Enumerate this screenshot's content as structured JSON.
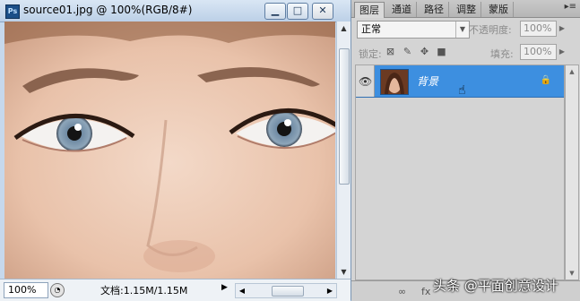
{
  "document": {
    "title": "source01.jpg @ 100%(RGB/8#)",
    "app_badge": "Ps",
    "buttons": {
      "minimize": "▁",
      "restore": "□",
      "close": "✕"
    },
    "status": {
      "zoom": "100%",
      "doc_info": "文档:1.15M/1.15M"
    }
  },
  "panel": {
    "tabs": [
      "图层",
      "通道",
      "路径",
      "调整",
      "蒙版"
    ],
    "active_tab": "图层",
    "blend_mode": "正常",
    "opacity_label": "不透明度:",
    "opacity_value": "100%",
    "lock_label": "锁定:",
    "fill_label": "填充:",
    "fill_value": "100%",
    "layers": [
      {
        "name": "背景",
        "selected": true,
        "locked": true,
        "visible": true
      }
    ]
  },
  "watermark": "头条 @平面创意设计"
}
